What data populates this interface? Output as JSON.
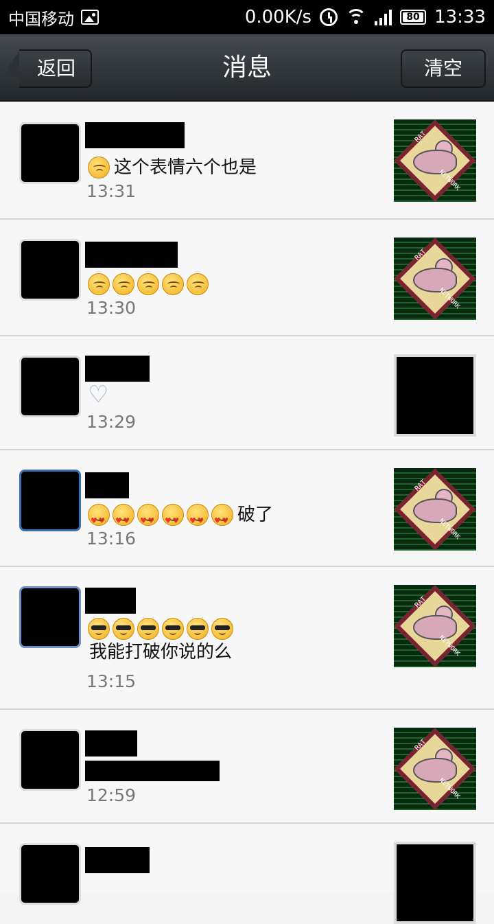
{
  "status_bar": {
    "carrier": "中国移动",
    "speed": "0.00K/s",
    "battery": "80",
    "time": "13:33"
  },
  "header": {
    "back_label": "返回",
    "title": "消息",
    "clear_label": "清空"
  },
  "rat_thumb": {
    "label_top": "RAT",
    "label_bottom": "NETWORK"
  },
  "messages": [
    {
      "emoji": "worried",
      "emoji_count": 1,
      "text": "这个表情六个也是",
      "time": "13:31"
    },
    {
      "emoji": "worried",
      "emoji_count": 5,
      "text": "",
      "time": "13:30"
    },
    {
      "emoji": "heart-icon",
      "emoji_count": 1,
      "text": "",
      "time": "13:29"
    },
    {
      "emoji": "love",
      "emoji_count": 6,
      "text": "破了",
      "time": "13:16"
    },
    {
      "emoji": "cool",
      "emoji_count": 6,
      "text": "我能打破你说的么",
      "time": "13:15"
    },
    {
      "emoji": "",
      "emoji_count": 0,
      "text": "",
      "time": "12:59"
    },
    {
      "emoji": "",
      "emoji_count": 0,
      "text": "",
      "time": ""
    }
  ]
}
